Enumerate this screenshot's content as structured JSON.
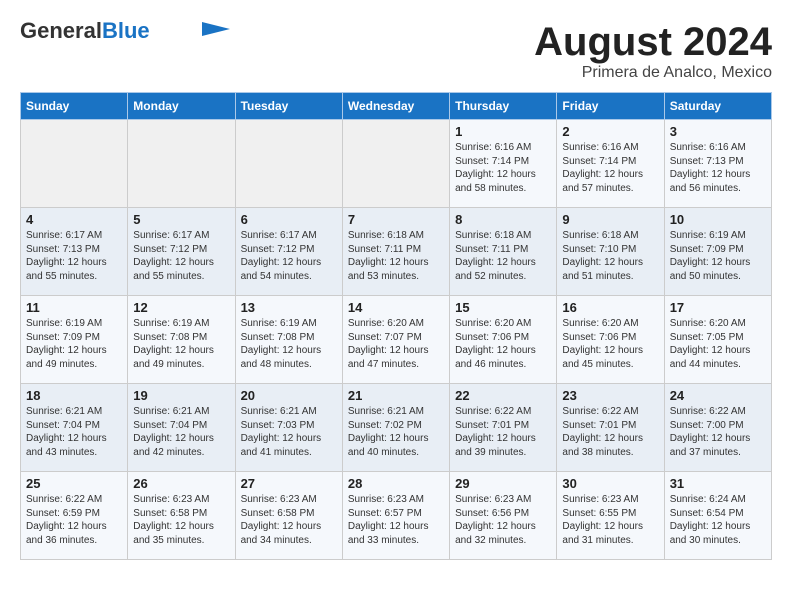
{
  "header": {
    "logo_general": "General",
    "logo_blue": "Blue",
    "month_title": "August 2024",
    "subtitle": "Primera de Analco, Mexico"
  },
  "weekdays": [
    "Sunday",
    "Monday",
    "Tuesday",
    "Wednesday",
    "Thursday",
    "Friday",
    "Saturday"
  ],
  "weeks": [
    [
      {
        "day": "",
        "info": ""
      },
      {
        "day": "",
        "info": ""
      },
      {
        "day": "",
        "info": ""
      },
      {
        "day": "",
        "info": ""
      },
      {
        "day": "1",
        "info": "Sunrise: 6:16 AM\nSunset: 7:14 PM\nDaylight: 12 hours\nand 58 minutes."
      },
      {
        "day": "2",
        "info": "Sunrise: 6:16 AM\nSunset: 7:14 PM\nDaylight: 12 hours\nand 57 minutes."
      },
      {
        "day": "3",
        "info": "Sunrise: 6:16 AM\nSunset: 7:13 PM\nDaylight: 12 hours\nand 56 minutes."
      }
    ],
    [
      {
        "day": "4",
        "info": "Sunrise: 6:17 AM\nSunset: 7:13 PM\nDaylight: 12 hours\nand 55 minutes."
      },
      {
        "day": "5",
        "info": "Sunrise: 6:17 AM\nSunset: 7:12 PM\nDaylight: 12 hours\nand 55 minutes."
      },
      {
        "day": "6",
        "info": "Sunrise: 6:17 AM\nSunset: 7:12 PM\nDaylight: 12 hours\nand 54 minutes."
      },
      {
        "day": "7",
        "info": "Sunrise: 6:18 AM\nSunset: 7:11 PM\nDaylight: 12 hours\nand 53 minutes."
      },
      {
        "day": "8",
        "info": "Sunrise: 6:18 AM\nSunset: 7:11 PM\nDaylight: 12 hours\nand 52 minutes."
      },
      {
        "day": "9",
        "info": "Sunrise: 6:18 AM\nSunset: 7:10 PM\nDaylight: 12 hours\nand 51 minutes."
      },
      {
        "day": "10",
        "info": "Sunrise: 6:19 AM\nSunset: 7:09 PM\nDaylight: 12 hours\nand 50 minutes."
      }
    ],
    [
      {
        "day": "11",
        "info": "Sunrise: 6:19 AM\nSunset: 7:09 PM\nDaylight: 12 hours\nand 49 minutes."
      },
      {
        "day": "12",
        "info": "Sunrise: 6:19 AM\nSunset: 7:08 PM\nDaylight: 12 hours\nand 49 minutes."
      },
      {
        "day": "13",
        "info": "Sunrise: 6:19 AM\nSunset: 7:08 PM\nDaylight: 12 hours\nand 48 minutes."
      },
      {
        "day": "14",
        "info": "Sunrise: 6:20 AM\nSunset: 7:07 PM\nDaylight: 12 hours\nand 47 minutes."
      },
      {
        "day": "15",
        "info": "Sunrise: 6:20 AM\nSunset: 7:06 PM\nDaylight: 12 hours\nand 46 minutes."
      },
      {
        "day": "16",
        "info": "Sunrise: 6:20 AM\nSunset: 7:06 PM\nDaylight: 12 hours\nand 45 minutes."
      },
      {
        "day": "17",
        "info": "Sunrise: 6:20 AM\nSunset: 7:05 PM\nDaylight: 12 hours\nand 44 minutes."
      }
    ],
    [
      {
        "day": "18",
        "info": "Sunrise: 6:21 AM\nSunset: 7:04 PM\nDaylight: 12 hours\nand 43 minutes."
      },
      {
        "day": "19",
        "info": "Sunrise: 6:21 AM\nSunset: 7:04 PM\nDaylight: 12 hours\nand 42 minutes."
      },
      {
        "day": "20",
        "info": "Sunrise: 6:21 AM\nSunset: 7:03 PM\nDaylight: 12 hours\nand 41 minutes."
      },
      {
        "day": "21",
        "info": "Sunrise: 6:21 AM\nSunset: 7:02 PM\nDaylight: 12 hours\nand 40 minutes."
      },
      {
        "day": "22",
        "info": "Sunrise: 6:22 AM\nSunset: 7:01 PM\nDaylight: 12 hours\nand 39 minutes."
      },
      {
        "day": "23",
        "info": "Sunrise: 6:22 AM\nSunset: 7:01 PM\nDaylight: 12 hours\nand 38 minutes."
      },
      {
        "day": "24",
        "info": "Sunrise: 6:22 AM\nSunset: 7:00 PM\nDaylight: 12 hours\nand 37 minutes."
      }
    ],
    [
      {
        "day": "25",
        "info": "Sunrise: 6:22 AM\nSunset: 6:59 PM\nDaylight: 12 hours\nand 36 minutes."
      },
      {
        "day": "26",
        "info": "Sunrise: 6:23 AM\nSunset: 6:58 PM\nDaylight: 12 hours\nand 35 minutes."
      },
      {
        "day": "27",
        "info": "Sunrise: 6:23 AM\nSunset: 6:58 PM\nDaylight: 12 hours\nand 34 minutes."
      },
      {
        "day": "28",
        "info": "Sunrise: 6:23 AM\nSunset: 6:57 PM\nDaylight: 12 hours\nand 33 minutes."
      },
      {
        "day": "29",
        "info": "Sunrise: 6:23 AM\nSunset: 6:56 PM\nDaylight: 12 hours\nand 32 minutes."
      },
      {
        "day": "30",
        "info": "Sunrise: 6:23 AM\nSunset: 6:55 PM\nDaylight: 12 hours\nand 31 minutes."
      },
      {
        "day": "31",
        "info": "Sunrise: 6:24 AM\nSunset: 6:54 PM\nDaylight: 12 hours\nand 30 minutes."
      }
    ]
  ]
}
